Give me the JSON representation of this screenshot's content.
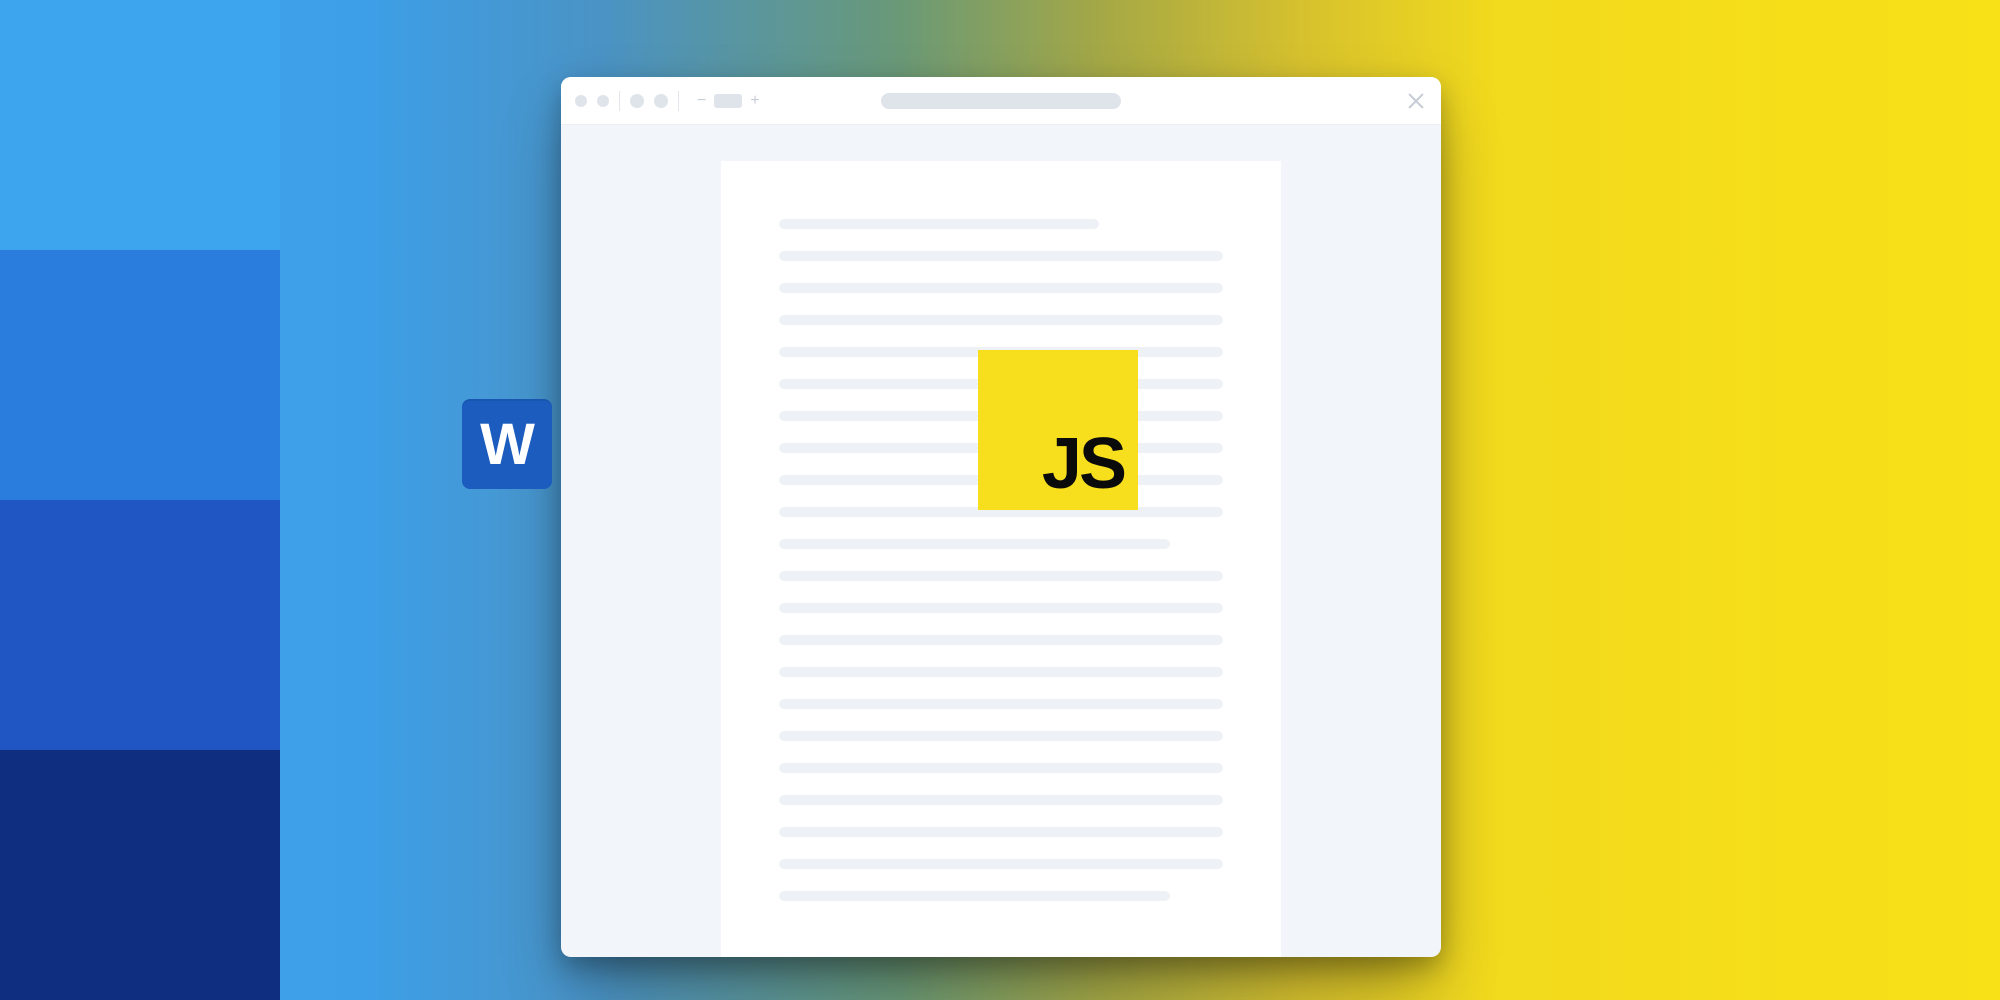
{
  "logos": {
    "word_letter": "W",
    "js_letters": "JS"
  },
  "titlebar": {
    "zoom_minus": "−",
    "zoom_plus": "+"
  },
  "colors": {
    "word_bg": "#1b5cbe",
    "js_bg": "#f7df1e",
    "stripe1": "#3da4ee",
    "stripe2": "#2b7ddd",
    "stripe3": "#1f56c4",
    "stripe4": "#0f2e7f"
  }
}
